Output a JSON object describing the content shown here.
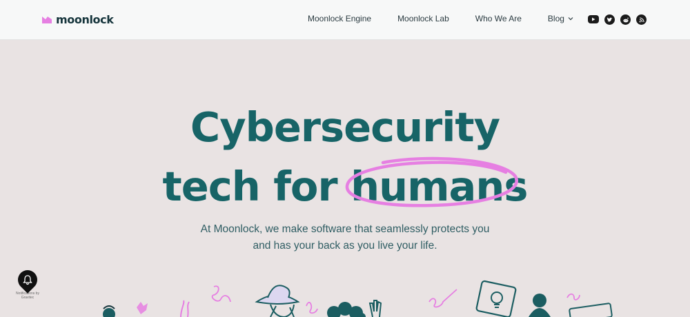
{
  "header": {
    "logo_text": "moonlock",
    "nav": [
      {
        "label": "Moonlock Engine"
      },
      {
        "label": "Moonlock Lab"
      },
      {
        "label": "Who We Are"
      },
      {
        "label": "Blog"
      }
    ],
    "social_icons": [
      "youtube-icon",
      "twitter-icon",
      "reddit-icon",
      "rss-icon"
    ]
  },
  "hero": {
    "title_line1": "Cybersecurity",
    "title_line2_prefix": "tech for ",
    "title_line2_highlight": "humans",
    "subtitle_line1": "At Moonlock, we make software that seamlessly protects you",
    "subtitle_line2": "and has your back as you live your life."
  },
  "notification_widget": {
    "caption_line1": "Notifications by",
    "caption_line2": "Gravitec"
  },
  "colors": {
    "accent_teal": "#176467",
    "accent_pink": "#e67fe2",
    "background": "#e9e3e3",
    "header_bg": "#f7f8f8"
  }
}
